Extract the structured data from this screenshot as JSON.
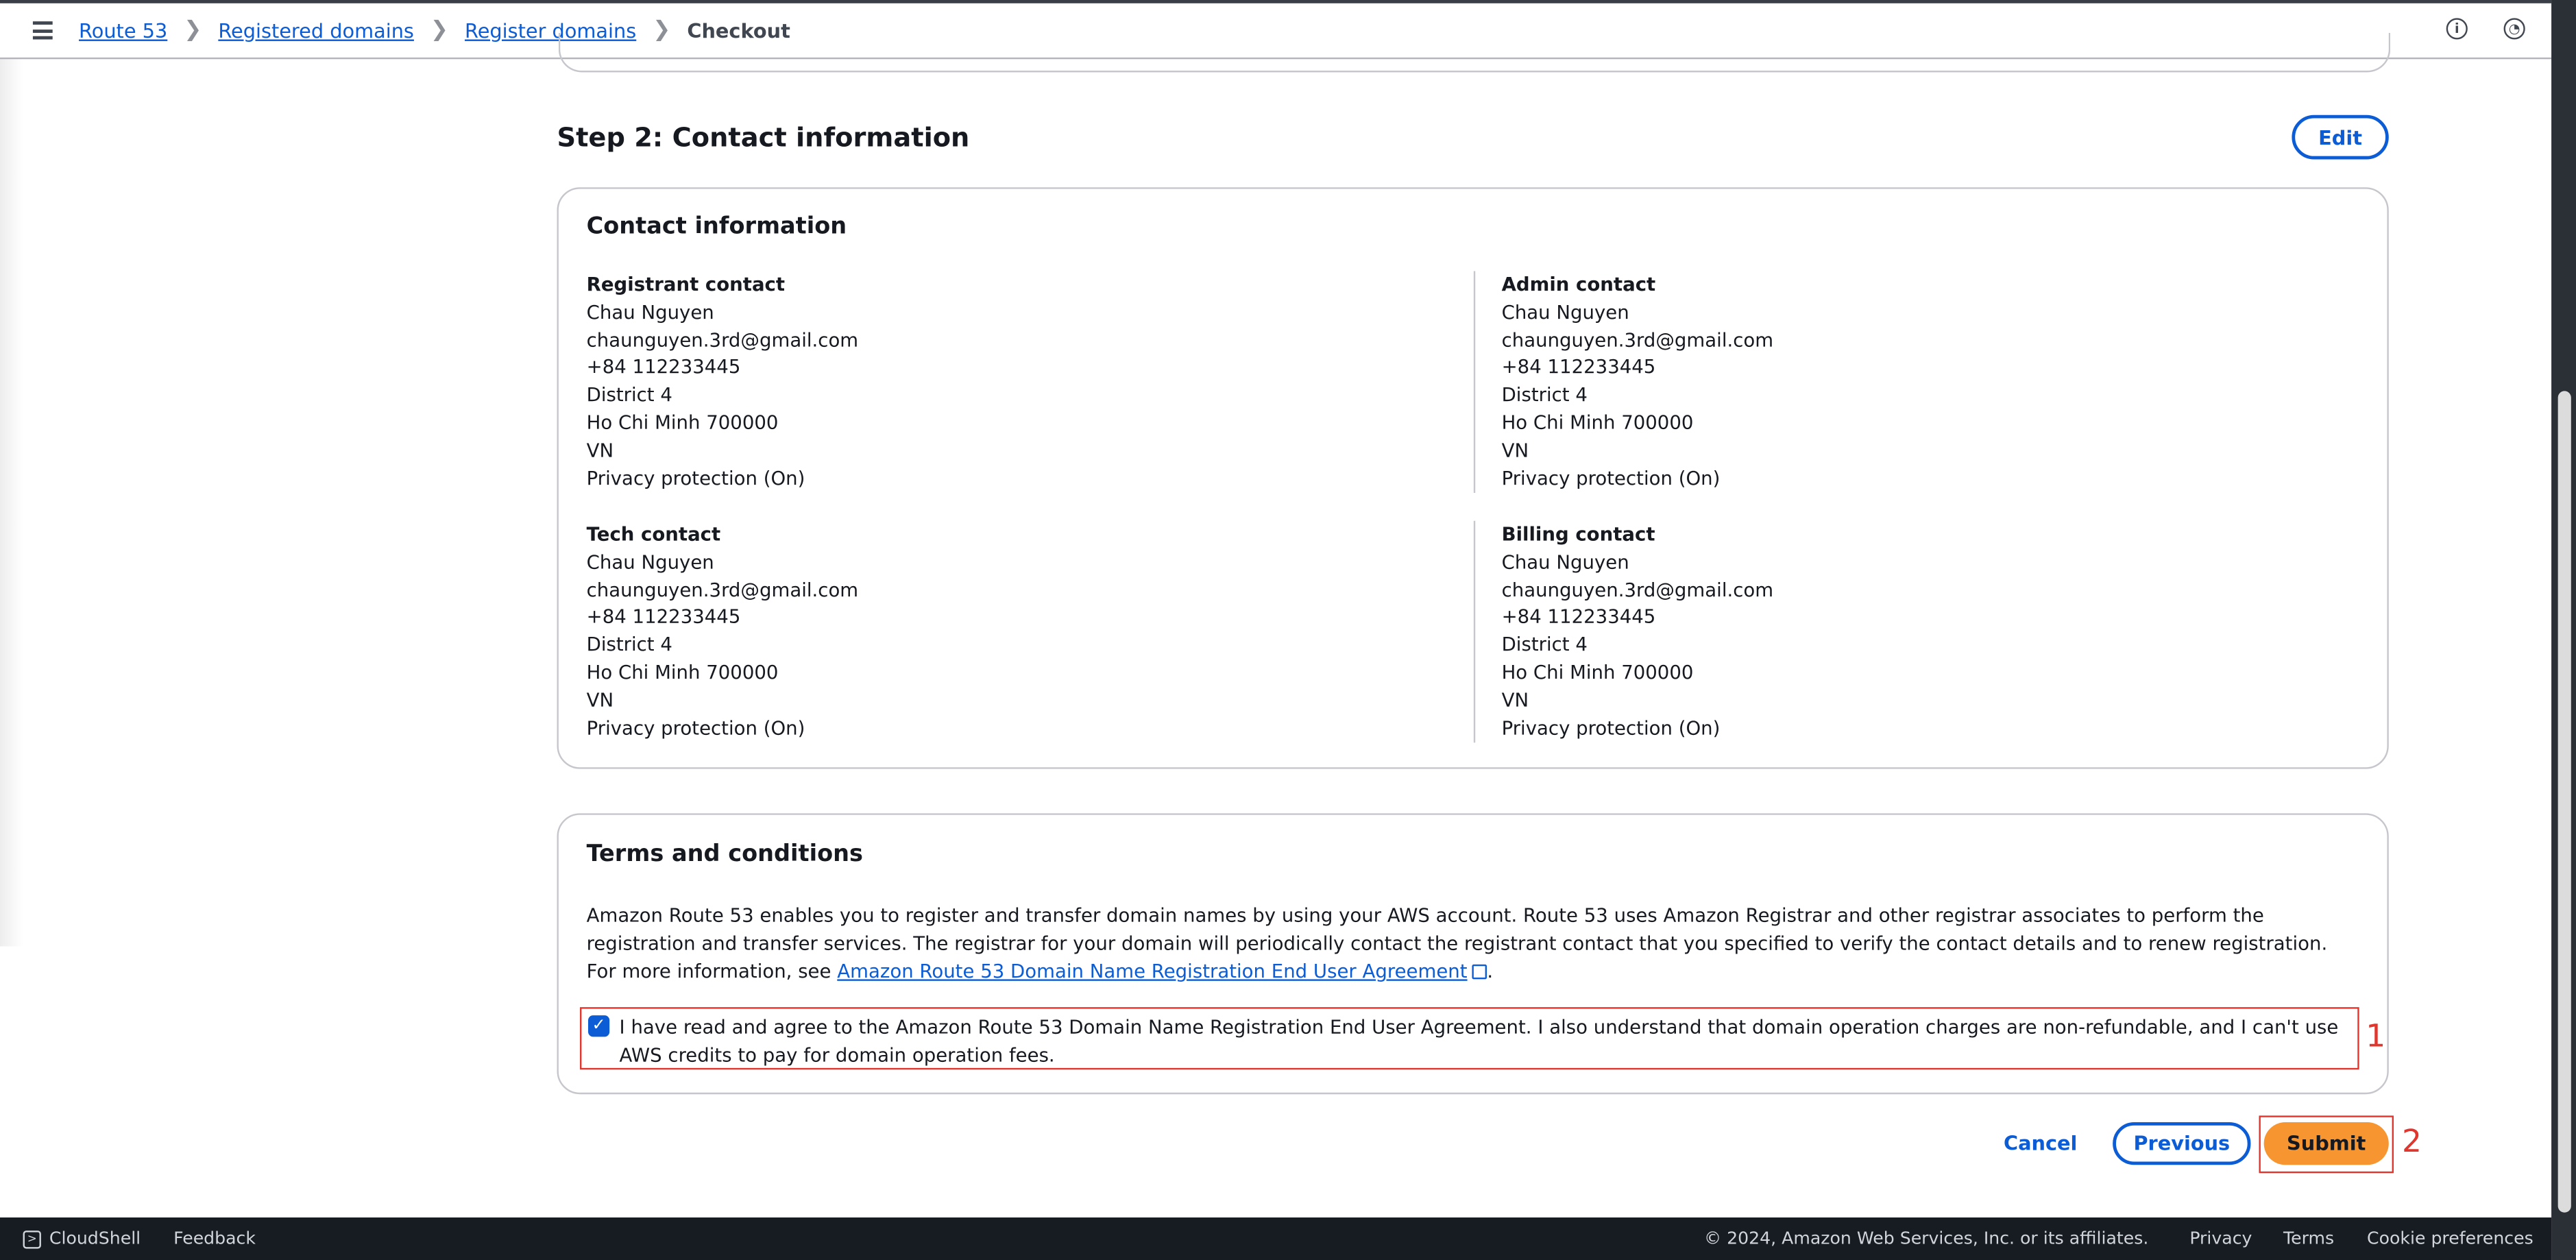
{
  "breadcrumb": [
    "Route 53",
    "Registered domains",
    "Register domains",
    "Checkout"
  ],
  "header_icons": [
    "info-icon",
    "notifications-icon"
  ],
  "step_title": "Step 2: Contact information",
  "edit_label": "Edit",
  "contact_card_title": "Contact information",
  "contacts": [
    {
      "title": "Registrant contact",
      "lines": [
        "Chau Nguyen",
        "chaunguyen.3rd@gmail.com",
        "+84 112233445",
        "District 4",
        "Ho Chi Minh 700000",
        "VN",
        "Privacy protection (On)"
      ]
    },
    {
      "title": "Admin contact",
      "lines": [
        "Chau Nguyen",
        "chaunguyen.3rd@gmail.com",
        "+84 112233445",
        "District 4",
        "Ho Chi Minh 700000",
        "VN",
        "Privacy protection (On)"
      ]
    },
    {
      "title": "Tech contact",
      "lines": [
        "Chau Nguyen",
        "chaunguyen.3rd@gmail.com",
        "+84 112233445",
        "District 4",
        "Ho Chi Minh 700000",
        "VN",
        "Privacy protection (On)"
      ]
    },
    {
      "title": "Billing contact",
      "lines": [
        "Chau Nguyen",
        "chaunguyen.3rd@gmail.com",
        "+84 112233445",
        "District 4",
        "Ho Chi Minh 700000",
        "VN",
        "Privacy protection (On)"
      ]
    }
  ],
  "terms": {
    "title": "Terms and conditions",
    "body": "Amazon Route 53 enables you to register and transfer domain names by using your AWS account. Route 53 uses Amazon Registrar and other registrar associates to perform the registration and transfer services. The registrar for your domain will periodically contact the registrant contact that you specified to verify the contact details and to renew registration. For more information, see ",
    "link": "Amazon Route 53 Domain Name Registration End User Agreement",
    "after": ".",
    "agree_text": "I have read and agree to the Amazon Route 53 Domain Name Registration End User Agreement. I also understand that domain operation charges are non-refundable, and I can't use AWS credits to pay for domain operation fees.",
    "agree_checked": true
  },
  "annotations": [
    "1",
    "2"
  ],
  "actions": {
    "cancel": "Cancel",
    "previous": "Previous",
    "submit": "Submit"
  },
  "footer": {
    "cloudshell": "CloudShell",
    "feedback": "Feedback",
    "copyright": "© 2024, Amazon Web Services, Inc. or its affiliates.",
    "privacy": "Privacy",
    "terms": "Terms",
    "cookies": "Cookie preferences"
  },
  "colors": {
    "link": "#0b5cd5",
    "primary": "#f79530",
    "annotation": "#e0362e",
    "footer": "#171b22"
  }
}
